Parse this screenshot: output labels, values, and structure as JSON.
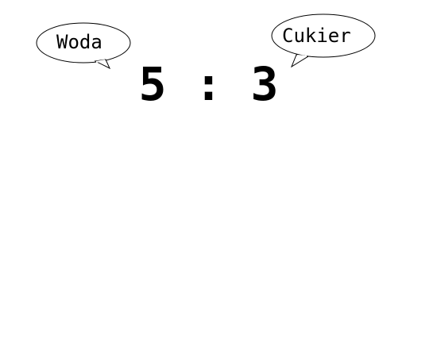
{
  "left_bubble": {
    "label": "Woda"
  },
  "right_bubble": {
    "label": "Cukier"
  },
  "ratio": {
    "left": "5",
    "separator": ":",
    "right": "3"
  }
}
